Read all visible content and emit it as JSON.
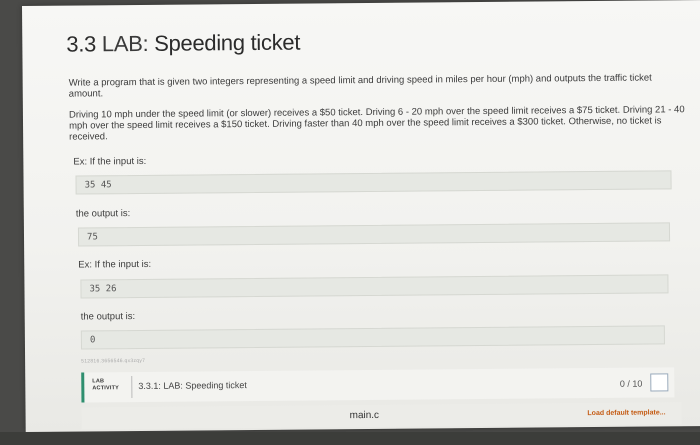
{
  "title": {
    "number": "3.3 ",
    "lab": "LAB: ",
    "name": "Speeding ticket"
  },
  "description": {
    "p1": "Write a program that is given two integers representing a speed limit and driving speed in miles per hour (mph) and outputs the traffic ticket amount.",
    "p2": "Driving 10 mph under the speed limit (or slower) receives a $50 ticket. Driving 6 - 20 mph over the speed limit receives a $75 ticket. Driving 21 - 40 mph over the speed limit receives a $150 ticket. Driving faster than 40 mph over the speed limit receives a $300 ticket. Otherwise, no ticket is received."
  },
  "examples": [
    {
      "input_label": "Ex: If the input is:",
      "input": "35 45",
      "output_label": "the output is:",
      "output": "75"
    },
    {
      "input_label": "Ex: If the input is:",
      "input": "35 26",
      "output_label": "the output is:",
      "output": "0"
    }
  ],
  "file_id": "512816.3656546.qx3zqy7",
  "activity": {
    "tag_line1": "LAB",
    "tag_line2": "ACTIVITY",
    "title": "3.3.1: LAB: Speeding ticket",
    "score": "0 / 10"
  },
  "editor": {
    "filename": "main.c",
    "load_template": "Load default template..."
  },
  "colors": {
    "accent": "#2f8f6f",
    "load_template": "#c45a12"
  }
}
